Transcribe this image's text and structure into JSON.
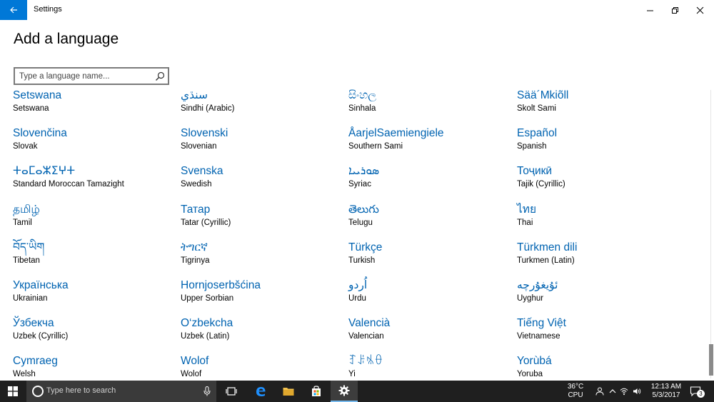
{
  "window": {
    "app_title": "Settings",
    "back_icon": "back-arrow-icon",
    "controls": [
      "minimize-icon",
      "restore-icon",
      "close-icon"
    ]
  },
  "page": {
    "title": "Add a language"
  },
  "search": {
    "placeholder": "Type a language name...",
    "value": "",
    "icon": "search-icon"
  },
  "languages": [
    {
      "native": "Setswana",
      "english": "Setswana"
    },
    {
      "native": "سنڌي",
      "english": "Sindhi (Arabic)"
    },
    {
      "native": "සිංහල",
      "english": "Sinhala"
    },
    {
      "native": "Sää´Mkiõll",
      "english": "Skolt Sami"
    },
    {
      "native": "Slovenčina",
      "english": "Slovak"
    },
    {
      "native": "Slovenski",
      "english": "Slovenian"
    },
    {
      "native": "ÅarjelSaemiengiele",
      "english": "Southern Sami"
    },
    {
      "native": "Español",
      "english": "Spanish"
    },
    {
      "native": "ⵜⴰⵎⴰⵣⵉⵖⵜ",
      "english": "Standard Moroccan Tamazight"
    },
    {
      "native": "Svenska",
      "english": "Swedish"
    },
    {
      "native": "ܣܘܪܝܝܐ",
      "english": "Syriac"
    },
    {
      "native": "Тоҷикӣ",
      "english": "Tajik (Cyrillic)"
    },
    {
      "native": "தமிழ்",
      "english": "Tamil"
    },
    {
      "native": "Татар",
      "english": "Tatar (Cyrillic)"
    },
    {
      "native": "తెలుగు",
      "english": "Telugu"
    },
    {
      "native": "ไทย",
      "english": "Thai"
    },
    {
      "native": "བོད་ཡིག",
      "english": "Tibetan"
    },
    {
      "native": "ትግርኛ",
      "english": "Tigrinya"
    },
    {
      "native": "Türkçe",
      "english": "Turkish"
    },
    {
      "native": "Türkmen dili",
      "english": "Turkmen (Latin)"
    },
    {
      "native": "Українська",
      "english": "Ukrainian"
    },
    {
      "native": "Hornjoserbšćina",
      "english": "Upper Sorbian"
    },
    {
      "native": "اُردو",
      "english": "Urdu"
    },
    {
      "native": "ئۇيغۇرچە",
      "english": "Uyghur"
    },
    {
      "native": "Ўзбекча",
      "english": "Uzbek (Cyrillic)"
    },
    {
      "native": "O‘zbekcha",
      "english": "Uzbek (Latin)"
    },
    {
      "native": "Valencià",
      "english": "Valencian"
    },
    {
      "native": "Tiếng Việt",
      "english": "Vietnamese"
    },
    {
      "native": "Cymraeg",
      "english": "Welsh"
    },
    {
      "native": "Wolof",
      "english": "Wolof"
    },
    {
      "native": "ꆈꌠꁱꂷ",
      "english": "Yi"
    },
    {
      "native": "Yorùbá",
      "english": "Yoruba"
    }
  ],
  "taskbar": {
    "search_text": "Type here to search",
    "weather_temp": "36°C",
    "weather_label": "CPU",
    "clock_time": "12:13 AM",
    "clock_date": "5/3/2017",
    "notification_count": "3",
    "accent_color": "#0078d7"
  }
}
